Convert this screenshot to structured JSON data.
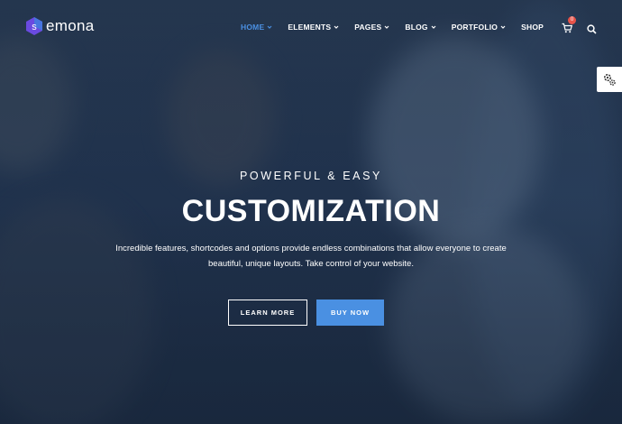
{
  "brand": {
    "logo_letter": "s",
    "name": "emona"
  },
  "nav": {
    "items": [
      {
        "label": "HOME",
        "has_dropdown": true,
        "active": true
      },
      {
        "label": "ELEMENTS",
        "has_dropdown": true,
        "active": false
      },
      {
        "label": "PAGES",
        "has_dropdown": true,
        "active": false
      },
      {
        "label": "BLOG",
        "has_dropdown": true,
        "active": false
      },
      {
        "label": "PORTFOLIO",
        "has_dropdown": true,
        "active": false
      },
      {
        "label": "SHOP",
        "has_dropdown": false,
        "active": false
      }
    ],
    "cart_count": "0",
    "icons": {
      "cart": "cart-icon",
      "search": "search-icon",
      "settings": "gears-icon"
    }
  },
  "hero": {
    "eyebrow": "POWERFUL & EASY",
    "headline": "CUSTOMIZATION",
    "description_line1": "Incredible features, shortcodes and options provide endless combinations that  allow everyone to create",
    "description_line2": "beautiful, unique layouts. Take control of your website.",
    "buttons": {
      "learn_more": "LEARN MORE",
      "buy_now": "BUY NOW"
    }
  },
  "colors": {
    "accent": "#4a90e2",
    "nav_active": "#4b90e2",
    "badge": "#e8544a",
    "overlay": "#223551",
    "text": "#ffffff"
  }
}
